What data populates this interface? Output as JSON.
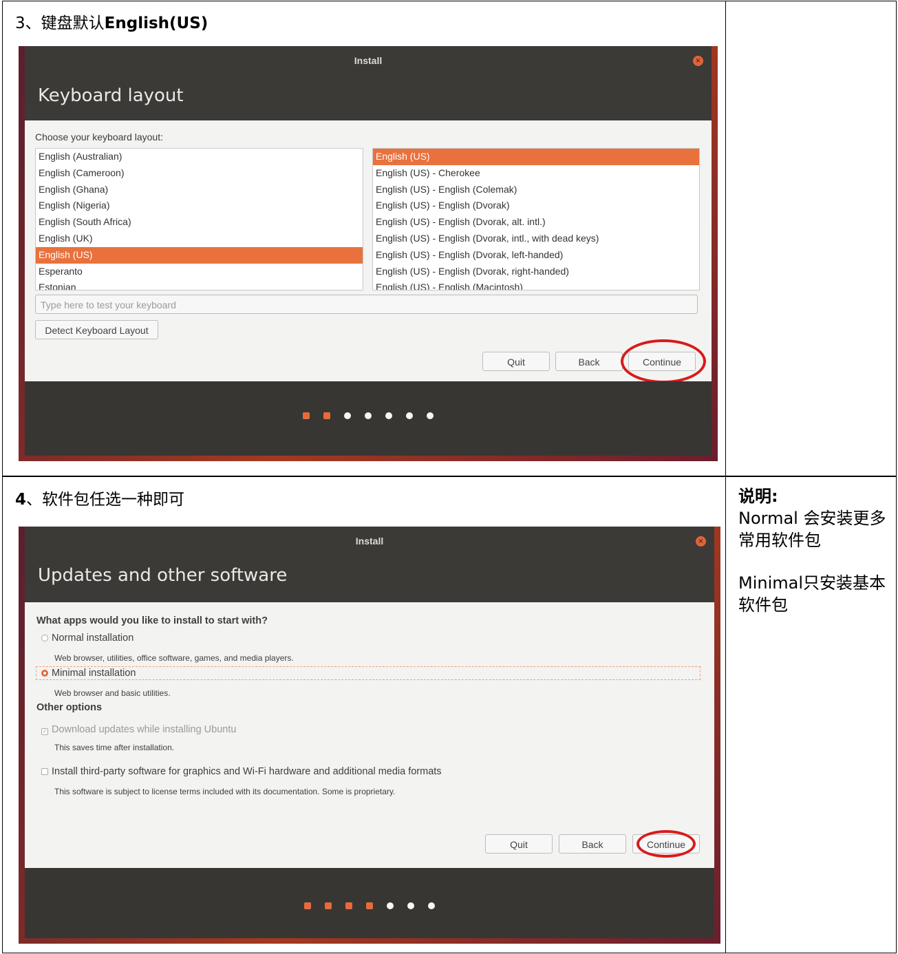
{
  "step3": {
    "title_prefix": "3、键盘默认",
    "title_bold": "English(US)",
    "window": {
      "title": "Install",
      "heading": "Keyboard layout",
      "choose_label": "Choose your keyboard layout:",
      "left_list": [
        "English (Australian)",
        "English (Cameroon)",
        "English (Ghana)",
        "English (Nigeria)",
        "English (South Africa)",
        "English (UK)",
        "English (US)",
        "Esperanto",
        "Estonian"
      ],
      "left_selected": "English (US)",
      "right_list": [
        "English (US)",
        "English (US) - Cherokee",
        "English (US) - English (Colemak)",
        "English (US) - English (Dvorak)",
        "English (US) - English (Dvorak, alt. intl.)",
        "English (US) - English (Dvorak, intl., with dead keys)",
        "English (US) - English (Dvorak, left-handed)",
        "English (US) - English (Dvorak, right-handed)",
        "English (US) - English (Macintosh)"
      ],
      "right_selected": "English (US)",
      "test_placeholder": "Type here to test your keyboard",
      "detect_label": "Detect Keyboard Layout",
      "quit_label": "Quit",
      "back_label": "Back",
      "continue_label": "Continue",
      "progress": {
        "current": 2,
        "total": 7
      }
    }
  },
  "step4": {
    "title_bold": "4",
    "title_rest": "、软件包任选一种即可",
    "window": {
      "title": "Install",
      "heading": "Updates and other software",
      "question": "What apps would you like to install to start with?",
      "normal_label": "Normal installation",
      "normal_desc": "Web browser, utilities, office software, games, and media players.",
      "minimal_label": "Minimal installation",
      "minimal_desc": "Web browser and basic utilities.",
      "other_options": "Other options",
      "download_label": "Download updates while installing Ubuntu",
      "download_desc": "This saves time after installation.",
      "thirdparty_label": "Install third-party software for graphics and Wi-Fi hardware and additional media formats",
      "thirdparty_desc": "This software is subject to license terms included with its documentation. Some is proprietary.",
      "selected_option": "Minimal installation",
      "download_checked": true,
      "thirdparty_checked": false,
      "quit_label": "Quit",
      "back_label": "Back",
      "continue_label": "Continue",
      "progress": {
        "current": 4,
        "total": 7
      }
    }
  },
  "note": {
    "label": "说明:",
    "line1": "Normal 会安装更多常用软件包",
    "line2": "Minimal只安装基本软件包"
  },
  "colors": {
    "accent": "#e9713d",
    "highlight_ring": "#d81b1b",
    "window_dark": "#3b3a37"
  }
}
